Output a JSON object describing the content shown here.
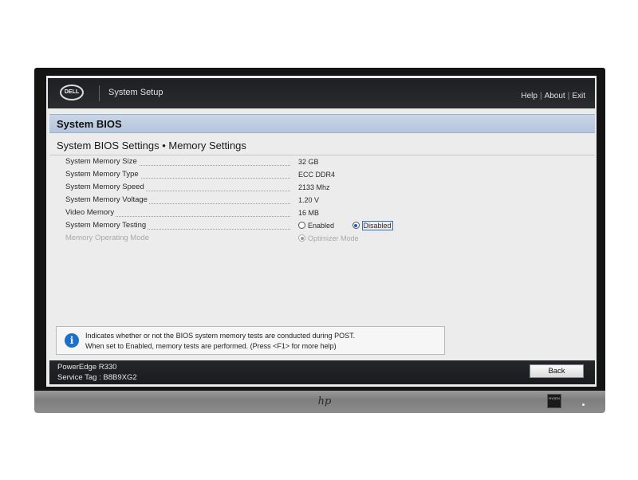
{
  "header": {
    "logo_text": "DELL",
    "title": "System Setup",
    "links": [
      "Help",
      "About",
      "Exit"
    ],
    "separator": "|"
  },
  "band": {
    "title": "System BIOS"
  },
  "page": {
    "title": "System BIOS Settings • Memory Settings"
  },
  "settings": [
    {
      "label": "System Memory Size",
      "value": "32 GB"
    },
    {
      "label": "System Memory Type",
      "value": "ECC DDR4"
    },
    {
      "label": "System Memory Speed",
      "value": "2133 Mhz"
    },
    {
      "label": "System Memory Voltage",
      "value": "1.20 V"
    },
    {
      "label": "Video Memory",
      "value": "16 MB"
    },
    {
      "label": "System Memory Testing",
      "options": [
        "Enabled",
        "Disabled"
      ],
      "selected": "Disabled"
    },
    {
      "label": "Memory Operating Mode",
      "options": [
        "Optimizer Mode"
      ],
      "selected": "Optimizer Mode",
      "disabled": true
    }
  ],
  "help": {
    "line1": "Indicates whether or not the BIOS system memory tests are conducted during POST.",
    "line2": "When set to Enabled, memory tests are performed. (Press <F1> for more help)"
  },
  "footer": {
    "model": "PowerEdge R330",
    "service_tag": "Service Tag : B8B9XG2",
    "back_label": "Back"
  },
  "monitor": {
    "brand": "hp",
    "sticker_text": "RYZEN"
  },
  "colors": {
    "header_bg": "#1e1f22",
    "band_bg": "#c9d6e8",
    "accent_blue": "#1d70c9",
    "screen_bg": "#ececec"
  }
}
